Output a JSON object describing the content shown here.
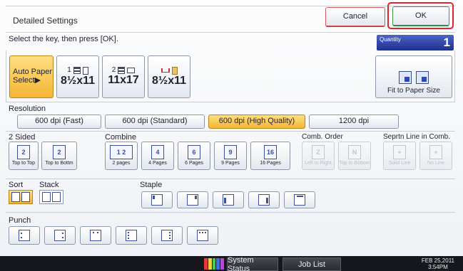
{
  "header": {
    "title": "Detailed Settings",
    "cancel_label": "Cancel",
    "ok_label": "OK"
  },
  "instruction": "Select the key, then press [OK].",
  "quantity": {
    "label": "Quantity",
    "value": "1"
  },
  "paper": {
    "auto_label_1": "Auto Paper",
    "auto_label_2": "Select▶",
    "trays": [
      {
        "num": "1",
        "size": "8½x11"
      },
      {
        "num": "2",
        "size": "11x17"
      },
      {
        "num": "",
        "size": "8½x11"
      }
    ],
    "fit_label": "Fit to Paper Size"
  },
  "resolution": {
    "label": "Resolution",
    "options": [
      "600 dpi (Fast)",
      "600 dpi (Standard)",
      "600 dpi (High Quality)",
      "1200 dpi"
    ],
    "selected": "600 dpi (High Quality)"
  },
  "two_sided": {
    "label": "2 Sided",
    "options": [
      "Top to Top",
      "Top to Bottm"
    ]
  },
  "combine": {
    "label": "Combine",
    "options": [
      "2 pages",
      "4 Pages",
      "6 Pages",
      "9 Pages",
      "16 Pages"
    ]
  },
  "comb_order": {
    "label": "Comb. Order",
    "options": [
      "Left to Right",
      "Top to Bottom"
    ]
  },
  "seprtn_line": {
    "label": "Seprtn Line in Comb.",
    "options": [
      "Solid Line",
      "No Line"
    ]
  },
  "sort_label": "Sort",
  "stack_label": "Stack",
  "staple_label": "Staple",
  "punch_label": "Punch",
  "taskbar": {
    "system_status": "System Status",
    "job_list": "Job List",
    "date": "FEB  25,2011",
    "time": "3:54PM"
  },
  "colors": {
    "selected": "#f4b534",
    "ok_accent": "#3c9b4f",
    "cancel_accent": "#d25a5a",
    "highlight_frame": "#e0232c",
    "quantity_bg": "#1f2f8c"
  }
}
